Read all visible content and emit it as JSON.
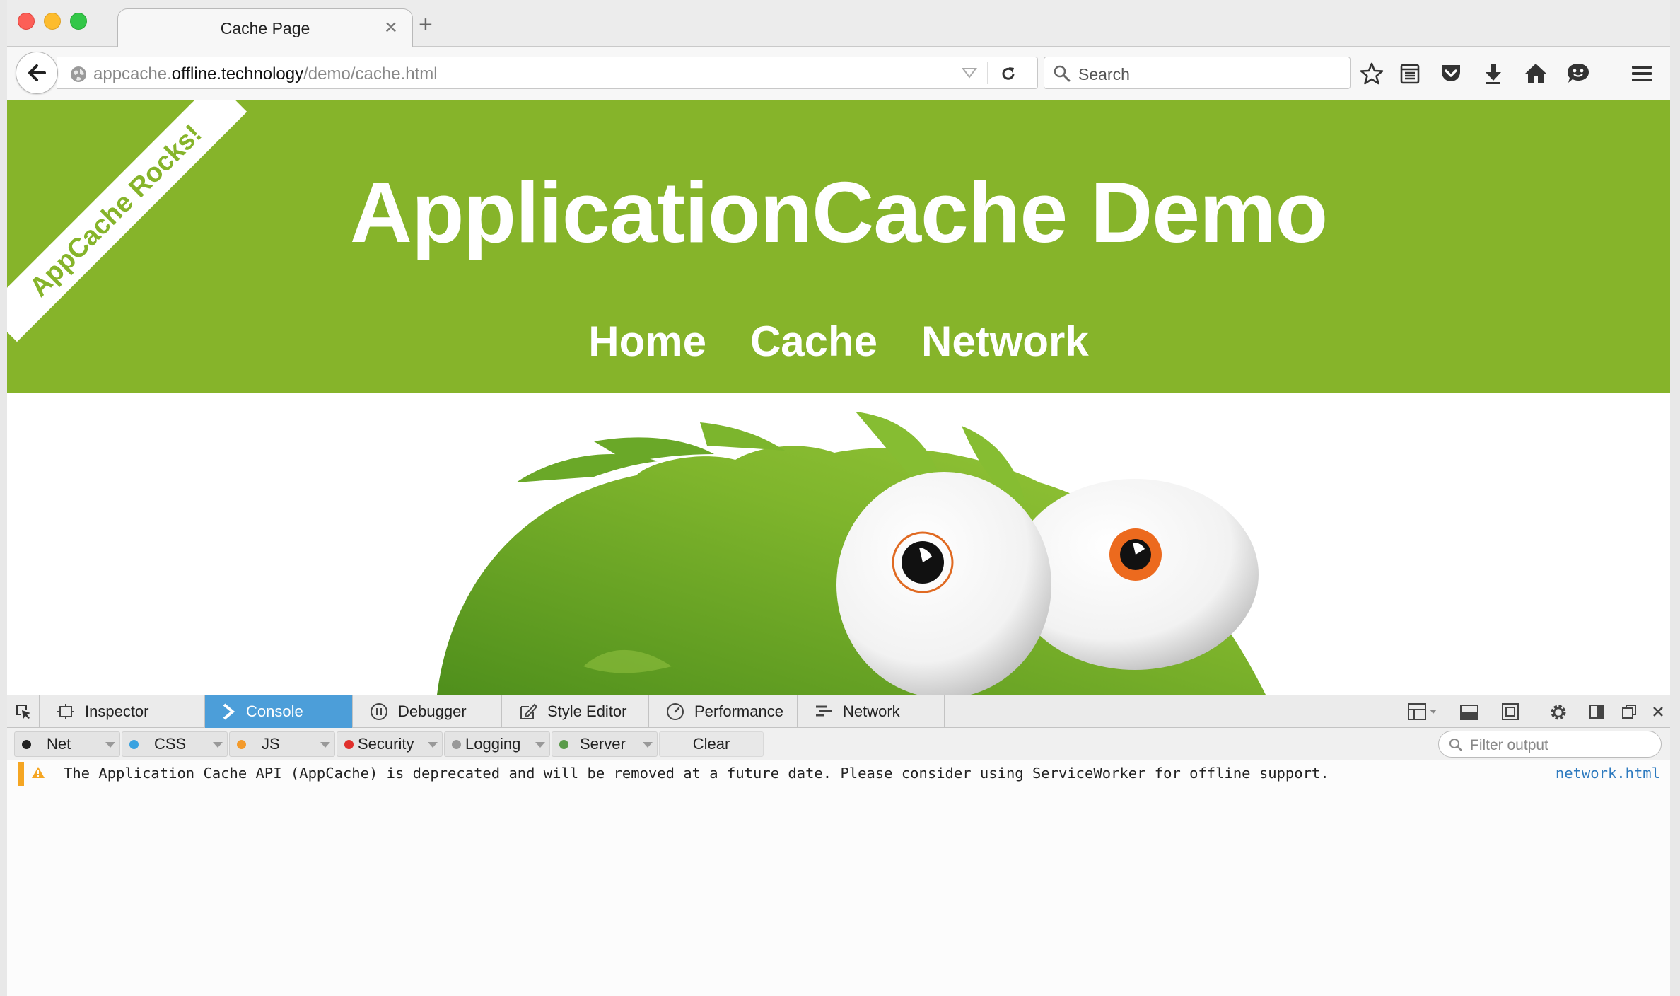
{
  "browser": {
    "tab": {
      "title": "Cache Page"
    },
    "url": {
      "prefix": "appcache.",
      "domain": "offline.technology",
      "path": "/demo/cache.html"
    },
    "search": {
      "placeholder": "Search"
    },
    "icons": [
      "back-icon",
      "globe-icon",
      "dropdown-icon",
      "reload-icon",
      "search-icon",
      "star-icon",
      "reading-list-icon",
      "pocket-icon",
      "download-icon",
      "home-icon",
      "chat-icon",
      "menu-icon"
    ]
  },
  "page": {
    "ribbon": "AppCache Rocks!",
    "title": "ApplicationCache Demo",
    "nav": {
      "home": "Home",
      "cache": "Cache",
      "network": "Network"
    },
    "colors": {
      "header": "#86b42a",
      "ribbon_text": "#86b42a"
    }
  },
  "devtools": {
    "tabs": {
      "inspector": "Inspector",
      "console": "Console",
      "debugger": "Debugger",
      "style_editor": "Style Editor",
      "performance": "Performance",
      "network": "Network"
    },
    "filters": {
      "net": "Net",
      "css": "CSS",
      "js": "JS",
      "security": "Security",
      "logging": "Logging",
      "server": "Server"
    },
    "clear": "Clear",
    "filter_placeholder": "Filter output",
    "message": {
      "text": "The Application Cache API (AppCache) is deprecated and will be removed at a future date.  Please consider using ServiceWorker for offline support.",
      "source": "network.html"
    },
    "colors": {
      "active_tab": "#4c9ed9",
      "net": "#222222",
      "css": "#3aa2e0",
      "js": "#f39a2b",
      "security": "#e0302c",
      "logging": "#999999",
      "server": "#5a9a4a"
    }
  }
}
